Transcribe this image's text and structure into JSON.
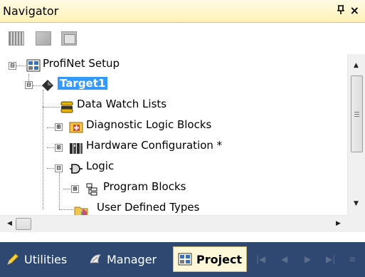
{
  "panel": {
    "title": "Navigator",
    "pin_glyph": "ᵖ",
    "close_glyph": "×"
  },
  "toolbar": {
    "buttons": [
      "list-view-icon",
      "tree-collapse-icon",
      "window-icon"
    ]
  },
  "tree": {
    "items": [
      {
        "label": "ProfiNet Setup",
        "icon": "network-config-icon",
        "expander": "⊟"
      },
      {
        "label": "Target1",
        "icon": "target-diamond-icon",
        "expander": "⊟",
        "selected": true
      },
      {
        "label": "Data Watch Lists",
        "icon": "watch-lists-icon"
      },
      {
        "label": "Diagnostic Logic Blocks",
        "icon": "diagnostic-blocks-icon",
        "expander": "⊞"
      },
      {
        "label": "Hardware Configuration *",
        "icon": "hardware-config-icon",
        "expander": "⊞"
      },
      {
        "label": "Logic",
        "icon": "logic-icon",
        "expander": "⊟"
      },
      {
        "label": "Program Blocks",
        "icon": "program-blocks-icon",
        "expander": "⊞"
      },
      {
        "label": "User Defined Types",
        "icon": "user-types-folder-icon"
      }
    ]
  },
  "scrollbars": {
    "vertical_up": "▲",
    "vertical_down": "▼",
    "horizontal_left": "◀",
    "horizontal_right": "▶"
  },
  "tabs": [
    {
      "label": "Utilities",
      "icon": "pencil-icon",
      "active": false
    },
    {
      "label": "Manager",
      "icon": "manager-icon",
      "active": false
    },
    {
      "label": "Project",
      "icon": "project-icon",
      "active": true
    }
  ],
  "tab_nav": {
    "first": "|◀",
    "prev": "◀",
    "next": "▶",
    "last": "▶|",
    "menu": "≡"
  },
  "colors": {
    "title_bar": "#fff1b5",
    "selection": "#3399ff",
    "tab_bar": "#2f4872",
    "active_tab": "#fff8d8"
  }
}
